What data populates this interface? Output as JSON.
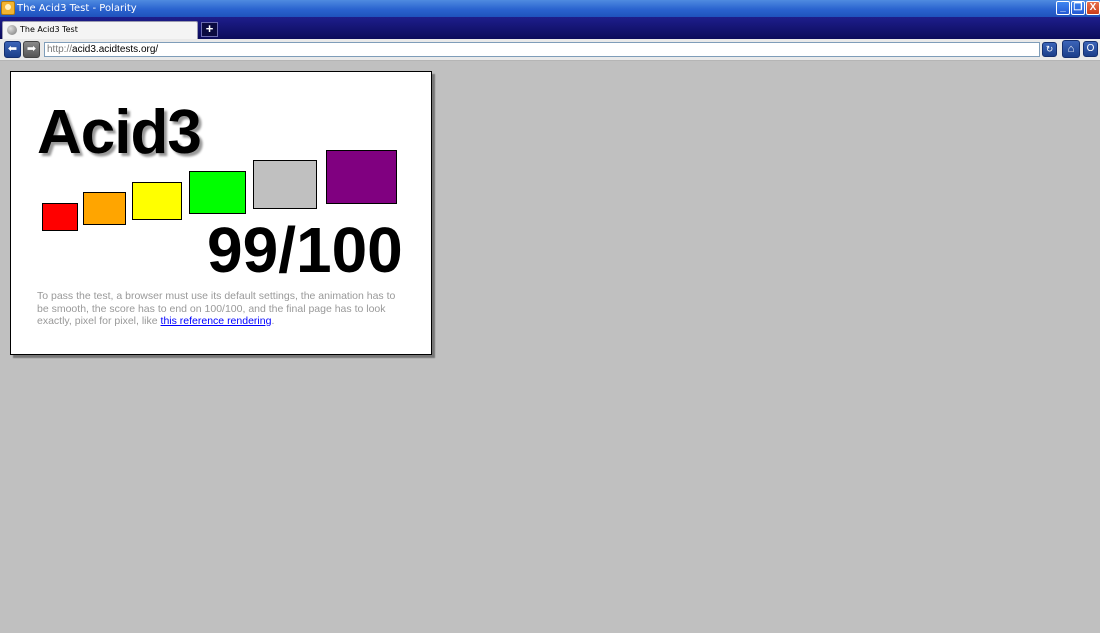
{
  "window": {
    "title": "The Acid3 Test - Polarity",
    "minimize_label": "_",
    "restore_label": "❐",
    "close_label": "X"
  },
  "tabs": [
    {
      "title": "The Acid3 Test",
      "icon": "globe-icon"
    }
  ],
  "new_tab_label": "+",
  "navigation": {
    "back_icon": "arrow-left-icon",
    "forward_icon": "arrow-right-icon",
    "url_scheme": "http://",
    "url_rest": "acid3.acidtests.org/",
    "reload_icon": "reload-icon",
    "home_icon": "home-icon",
    "options_label": "O"
  },
  "page": {
    "heading": "Acid3",
    "score": "99/100",
    "boxes": [
      {
        "name": "box-red",
        "color": "#ff0000"
      },
      {
        "name": "box-orange",
        "color": "#ffa500"
      },
      {
        "name": "box-yellow",
        "color": "#ffff00"
      },
      {
        "name": "box-lime",
        "color": "#00ff00"
      },
      {
        "name": "box-silver",
        "color": "#c0c0c0"
      },
      {
        "name": "box-purple",
        "color": "#800080"
      }
    ],
    "description": "To pass the test, a browser must use its default settings, the animation has to be smooth, the score has to end on 100/100, and the final page has to look exactly, pixel for pixel, like ",
    "link_text": "this reference rendering",
    "description_end": "."
  }
}
